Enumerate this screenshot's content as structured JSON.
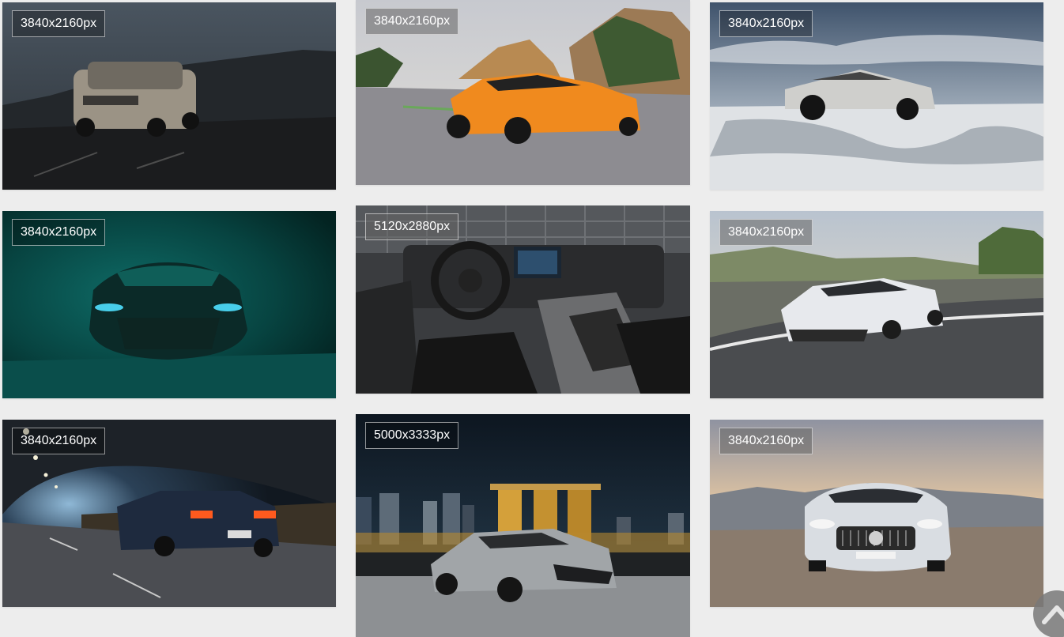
{
  "gallery": {
    "items": [
      {
        "resolution": "3840x2160px",
        "icon": "suv-photo"
      },
      {
        "resolution": "3840x2160px",
        "icon": "orange-supercar-photo"
      },
      {
        "resolution": "3840x2160px",
        "icon": "cybertruck-snow-photo"
      },
      {
        "resolution": "3840x2160px",
        "icon": "teal-coupe-photo"
      },
      {
        "resolution": "5120x2880px",
        "icon": "truck-interior-photo"
      },
      {
        "resolution": "3840x2160px",
        "icon": "white-supercar-track-photo"
      },
      {
        "resolution": "3840x2160px",
        "icon": "muscle-car-tunnel-photo"
      },
      {
        "resolution": "5000x3333px",
        "icon": "supercar-city-night-photo"
      },
      {
        "resolution": "3840x2160px",
        "icon": "silver-gt-car-photo"
      }
    ]
  },
  "scroll_top": {
    "icon": "chevron-up-icon"
  },
  "colors": {
    "page_background": "#ededed",
    "badge_text": "#ffffff",
    "scroll_button": "#787878"
  }
}
